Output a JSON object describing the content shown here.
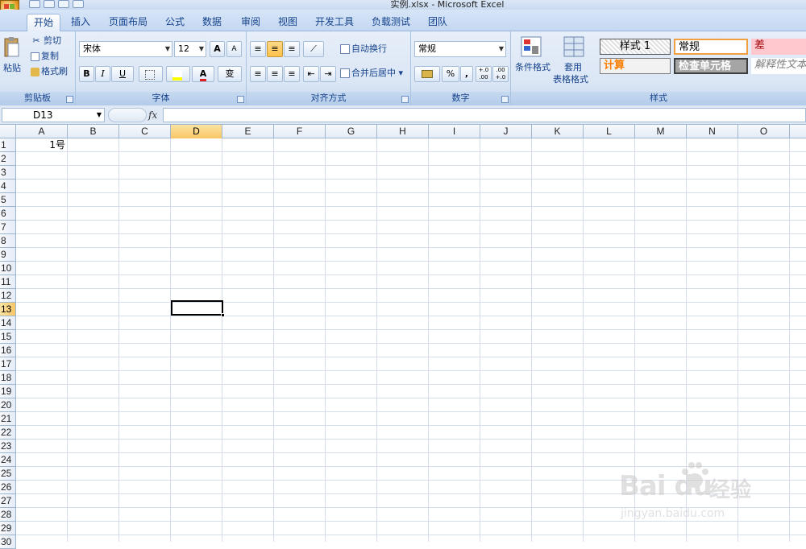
{
  "window": {
    "title": "实例.xlsx - Microsoft Excel"
  },
  "tabs": [
    {
      "label": "开始",
      "active": true
    },
    {
      "label": "插入"
    },
    {
      "label": "页面布局"
    },
    {
      "label": "公式"
    },
    {
      "label": "数据"
    },
    {
      "label": "审阅"
    },
    {
      "label": "视图"
    },
    {
      "label": "开发工具"
    },
    {
      "label": "负载测试"
    },
    {
      "label": "团队"
    }
  ],
  "ribbon": {
    "clipboard": {
      "label": "剪贴板",
      "paste": "粘贴",
      "cut": "剪切",
      "copy": "复制",
      "format_painter": "格式刷"
    },
    "font": {
      "label": "字体",
      "name": "宋体",
      "size": "12",
      "bold": "B",
      "italic": "I",
      "underline": "U",
      "grow": "A",
      "shrink": "A",
      "color_letter": "A",
      "phonetic": "变"
    },
    "alignment": {
      "label": "对齐方式",
      "wrap": "自动换行",
      "merge": "合并后居中"
    },
    "number": {
      "label": "数字",
      "format": "常规",
      "percent": "%",
      "comma": ",",
      "inc_decimal": "+.0 .00",
      "dec_decimal": ".00 +.0"
    },
    "styles": {
      "label": "样式",
      "conditional": "条件格式",
      "table_format_1": "套用",
      "table_format_2": "表格格式",
      "cells": [
        {
          "text": "样式 1"
        },
        {
          "text": "常规"
        },
        {
          "text": "差"
        },
        {
          "text": "计算"
        },
        {
          "text": "检查单元格"
        },
        {
          "text": "解释性文本"
        }
      ]
    }
  },
  "formula_bar": {
    "name_box": "D13",
    "fx": "fx",
    "content": ""
  },
  "sheet": {
    "columns": [
      "A",
      "B",
      "C",
      "D",
      "E",
      "F",
      "G",
      "H",
      "I",
      "J",
      "K",
      "L",
      "M",
      "N",
      "O"
    ],
    "rows": [
      "1",
      "2",
      "3",
      "4",
      "5",
      "6",
      "7",
      "8",
      "9",
      "10",
      "11",
      "12",
      "13",
      "14",
      "15",
      "16",
      "17",
      "18",
      "19",
      "20",
      "21",
      "22",
      "23",
      "24",
      "25",
      "26",
      "27",
      "28",
      "29",
      "30"
    ],
    "active_column": "D",
    "active_row": "13",
    "cells": {
      "A1": "1号"
    }
  },
  "watermark": {
    "logo": "Bai du",
    "brand_cn": "经验",
    "url": "jingyan.baidu.com"
  }
}
